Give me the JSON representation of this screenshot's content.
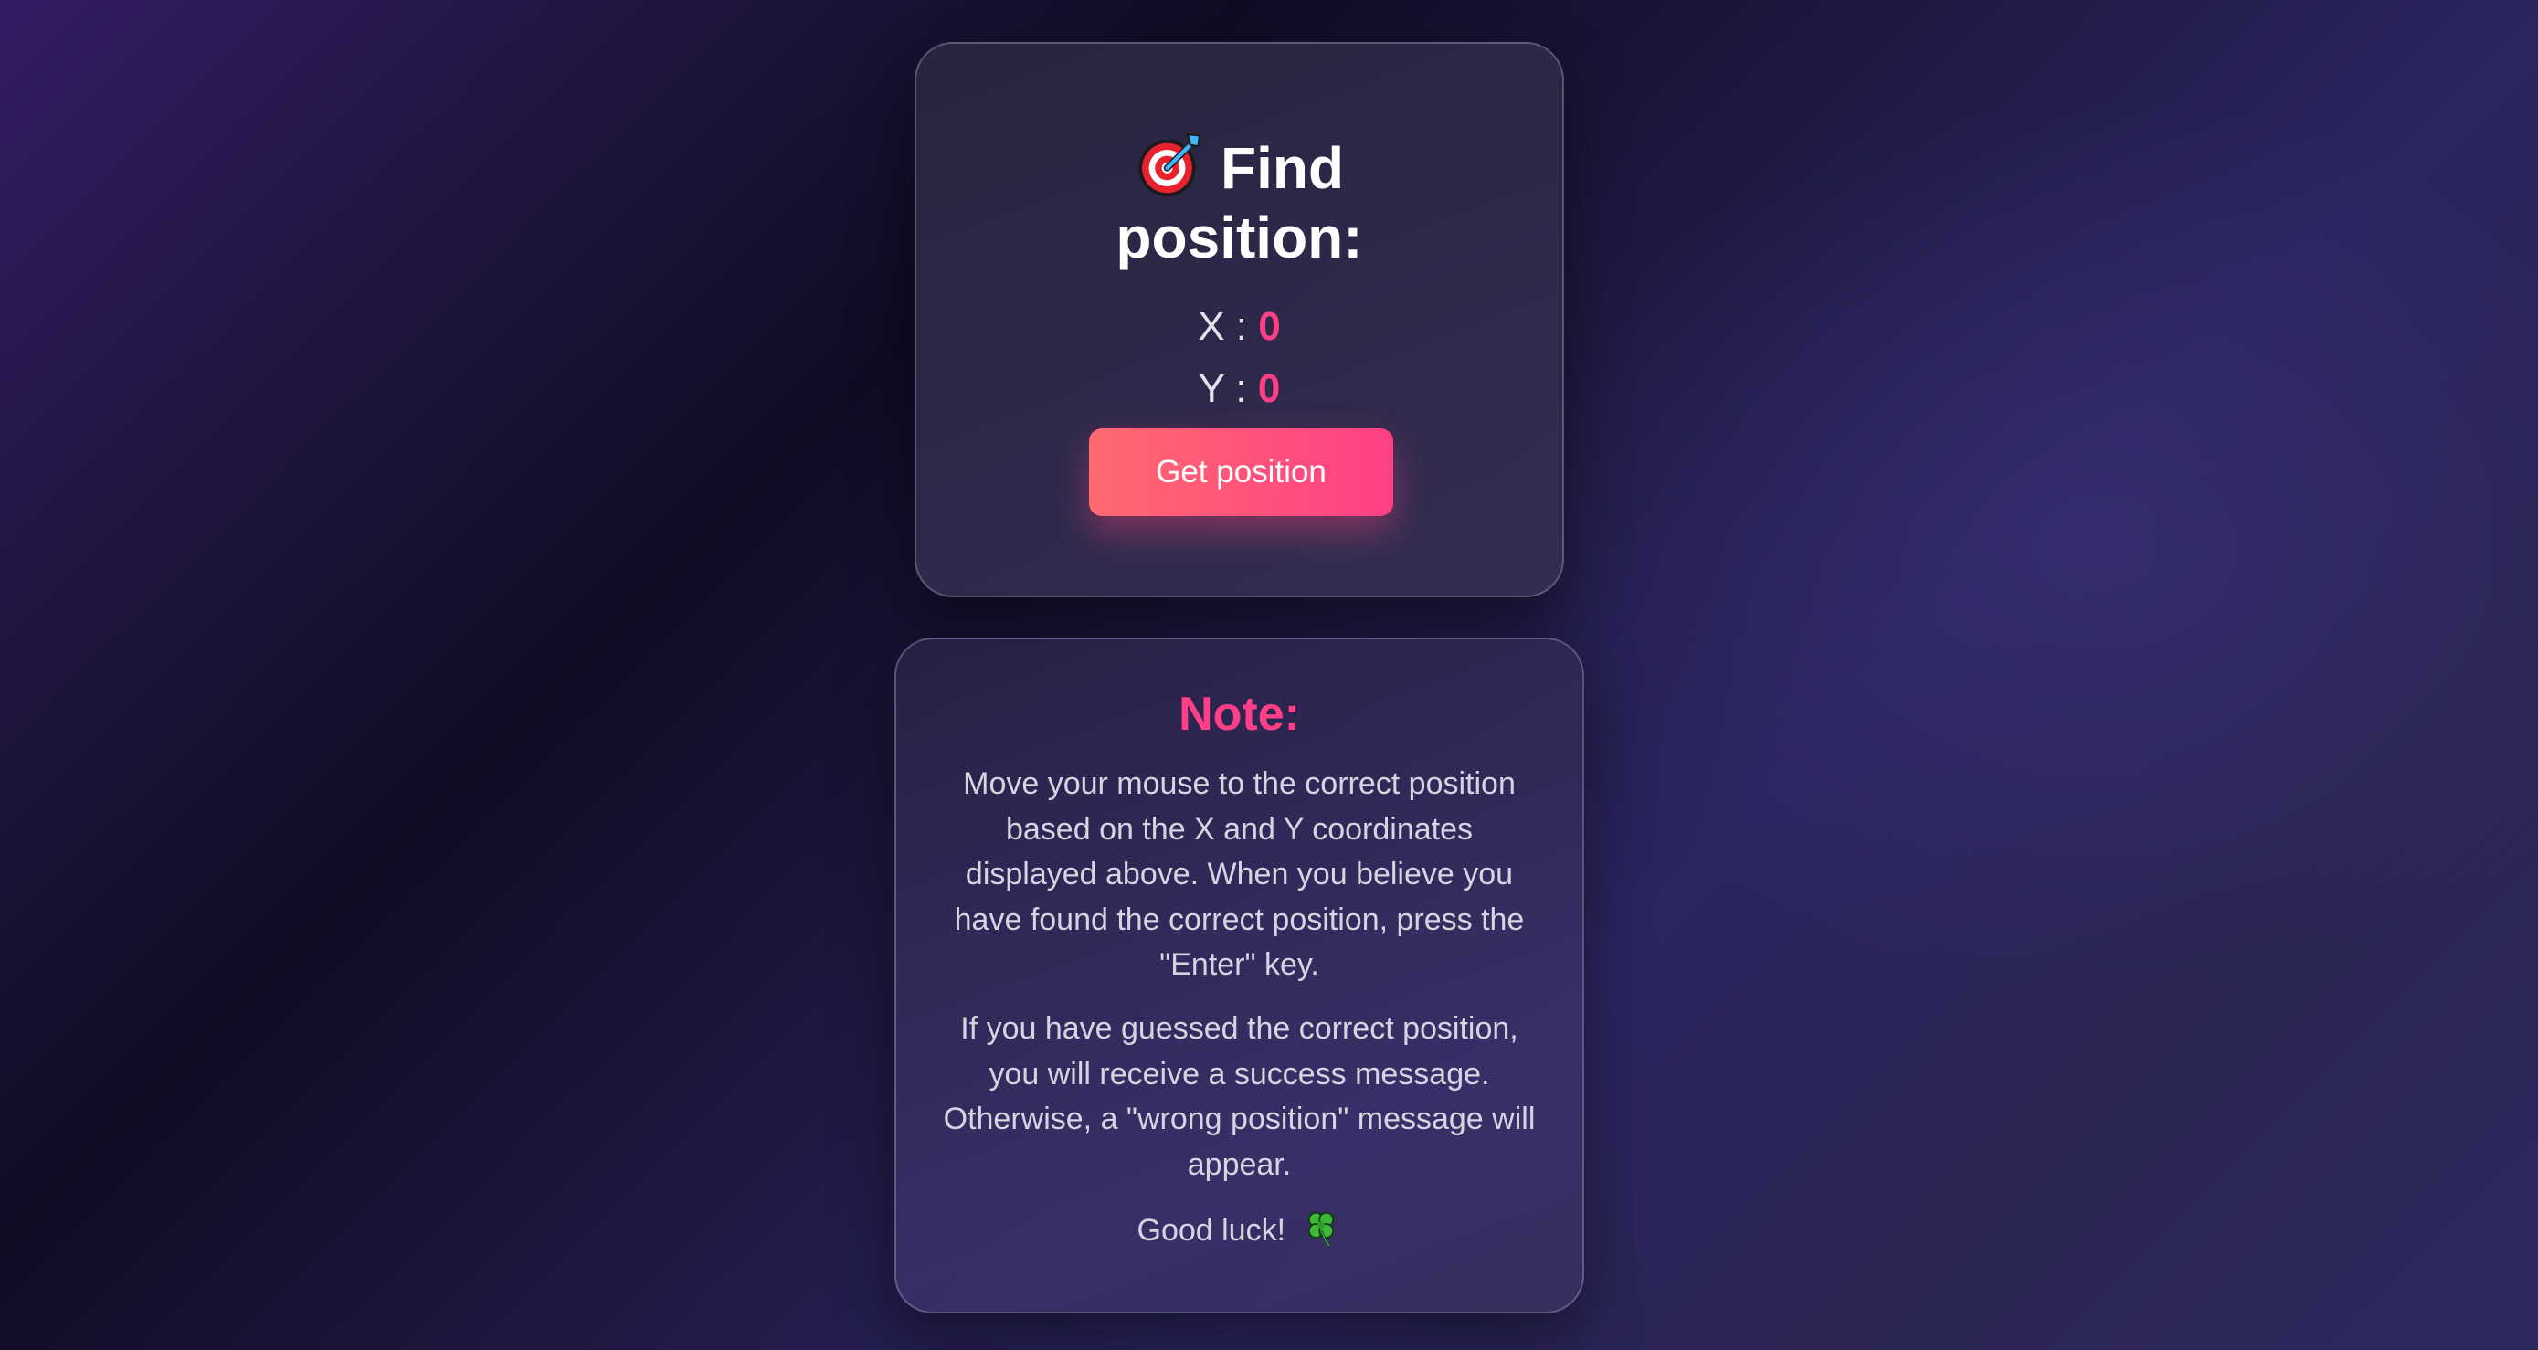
{
  "position_card": {
    "title_line1": "Find",
    "title_line2": "position:",
    "title_icon": "target-icon",
    "x_label": "X :",
    "x_value": "0",
    "y_label": "Y :",
    "y_value": "0",
    "button_label": "Get position"
  },
  "note_card": {
    "title": "Note:",
    "paragraph1": "Move your mouse to the correct position based on the X and Y coordinates displayed above. When you believe you have found the correct position, press the \"Enter\" key.",
    "paragraph2": "If you have guessed the correct position, you will receive a success message. Otherwise, a \"wrong position\" message will appear.",
    "paragraph3": "Good luck!",
    "paragraph3_icon": "four-leaf-clover-icon"
  },
  "colors": {
    "accent": "#ff3f86",
    "button_gradient_start": "#ff6a6f",
    "button_gradient_end": "#ff3f86",
    "title_text": "#ffffff",
    "body_text": "#d7d4e2"
  }
}
